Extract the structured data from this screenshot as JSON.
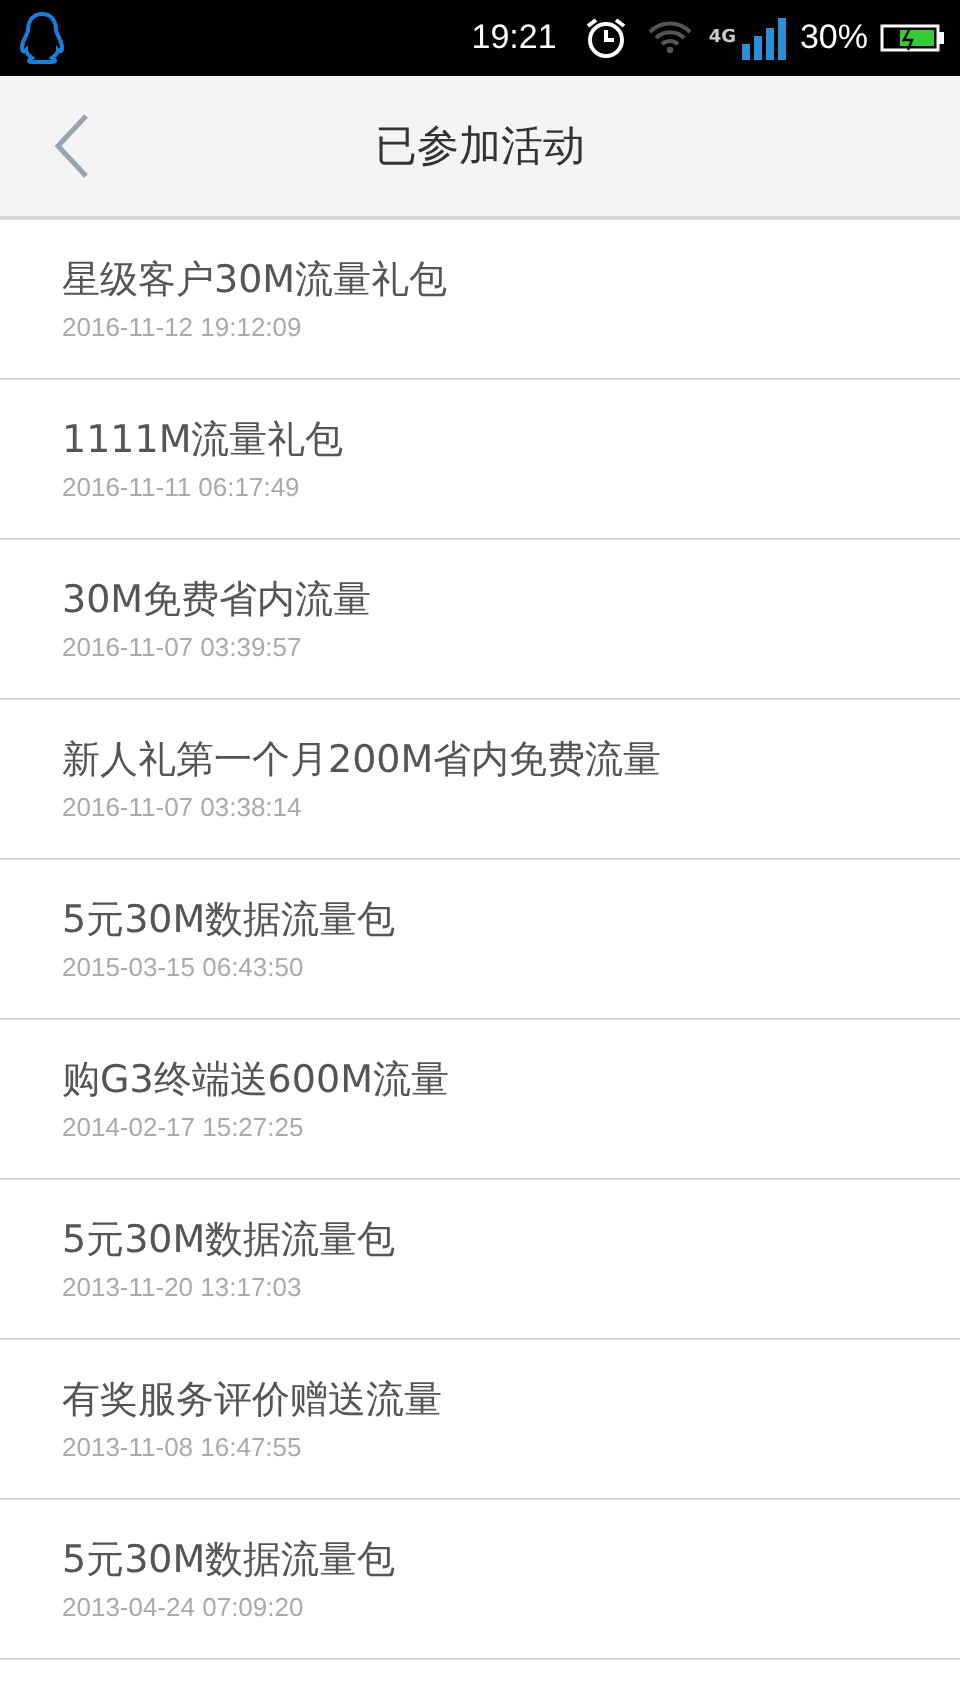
{
  "status_bar": {
    "time": "19:21",
    "network": "4G",
    "battery": "30%"
  },
  "header": {
    "title": "已参加活动"
  },
  "items": [
    {
      "title": "星级客户30M流量礼包",
      "date": "2016-11-12 19:12:09"
    },
    {
      "title": "1111M流量礼包",
      "date": "2016-11-11 06:17:49"
    },
    {
      "title": "30M免费省内流量",
      "date": "2016-11-07 03:39:57"
    },
    {
      "title": "新人礼第一个月200M省内免费流量",
      "date": "2016-11-07 03:38:14"
    },
    {
      "title": "5元30M数据流量包",
      "date": "2015-03-15 06:43:50"
    },
    {
      "title": "购G3终端送600M流量",
      "date": "2014-02-17 15:27:25"
    },
    {
      "title": "5元30M数据流量包",
      "date": "2013-11-20 13:17:03"
    },
    {
      "title": "有奖服务评价赠送流量",
      "date": "2013-11-08 16:47:55"
    },
    {
      "title": "5元30M数据流量包",
      "date": "2013-04-24 07:09:20"
    }
  ]
}
